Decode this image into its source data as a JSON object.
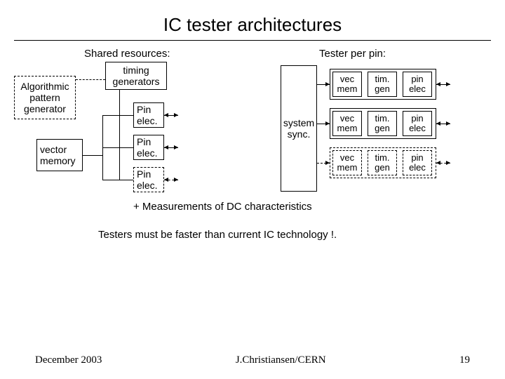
{
  "title": "IC tester architectures",
  "left": {
    "heading": "Shared resources:",
    "algPatGen": "Algorithmic\npattern\ngenerator",
    "timingGen": "timing\ngenerators",
    "vectorMem": "vector\nmemory",
    "pinElec": "Pin\nelec."
  },
  "right": {
    "heading": "Tester per pin:",
    "systemSync": "system\nsync.",
    "vecMem": "vec\nmem",
    "timGen": "tim.\ngen",
    "pinElec": "pin\nelec"
  },
  "notes": {
    "dc": "+ Measurements of DC characteristics",
    "speed": "Testers must be faster than current IC technology !."
  },
  "footer": {
    "date": "December 2003",
    "author": "J.Christiansen/CERN",
    "page": "19"
  }
}
